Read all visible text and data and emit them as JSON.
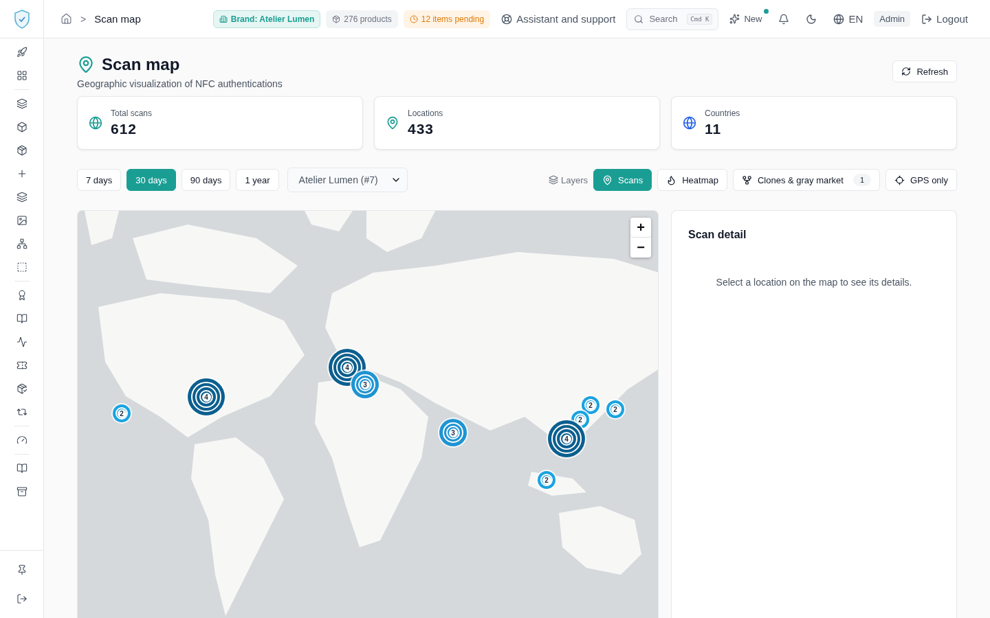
{
  "breadcrumb": {
    "current": "Scan map",
    "separator": ">"
  },
  "header_badges": [
    {
      "kind": "brand",
      "label": "Brand: Atelier Lumen"
    },
    {
      "kind": "products",
      "label": "276 products"
    },
    {
      "kind": "pending",
      "label": "12 items pending"
    }
  ],
  "header": {
    "support": "Assistant and support",
    "search": {
      "placeholder": "Search",
      "shortcut": "Cmd K"
    },
    "new": {
      "label": "New",
      "unread": true
    },
    "language": "EN",
    "role": "Admin",
    "logout": "Logout"
  },
  "page": {
    "title": "Scan map",
    "subtitle": "Geographic visualization of NFC authentications",
    "refresh": "Refresh"
  },
  "stats": [
    {
      "kind": "globe",
      "label": "Total scans",
      "value": "612"
    },
    {
      "kind": "pin",
      "label": "Locations",
      "value": "433"
    },
    {
      "kind": "countries",
      "label": "Countries",
      "value": "11"
    }
  ],
  "periods": [
    {
      "label": "7 days",
      "selected": false
    },
    {
      "label": "30 days",
      "selected": true
    },
    {
      "label": "90 days",
      "selected": false
    },
    {
      "label": "1 year",
      "selected": false
    }
  ],
  "brand_select": {
    "value": "Atelier Lumen (#7)"
  },
  "layers": {
    "label": "Layers",
    "options": [
      {
        "kind": "scans",
        "label": "Scans",
        "selected": true
      },
      {
        "kind": "heatmap",
        "label": "Heatmap",
        "selected": false
      },
      {
        "kind": "clones",
        "label": "Clones & gray market",
        "selected": false,
        "count": "1"
      },
      {
        "kind": "gps",
        "label": "GPS only",
        "selected": false
      }
    ]
  },
  "map": {
    "zoom_in": "+",
    "zoom_out": "−",
    "clusters": [
      {
        "count": "2",
        "kind": "small"
      },
      {
        "count": "4",
        "kind": "large"
      },
      {
        "count": "4",
        "kind": "large"
      },
      {
        "count": "3",
        "kind": "medium"
      },
      {
        "count": "3",
        "kind": "medium"
      },
      {
        "count": "2",
        "kind": "small"
      },
      {
        "count": "2",
        "kind": "small"
      },
      {
        "count": "2",
        "kind": "small"
      },
      {
        "count": "4",
        "kind": "large"
      },
      {
        "count": "2",
        "kind": "small"
      }
    ]
  },
  "detail": {
    "title": "Scan detail",
    "empty": "Select a location on the map to see its details."
  }
}
